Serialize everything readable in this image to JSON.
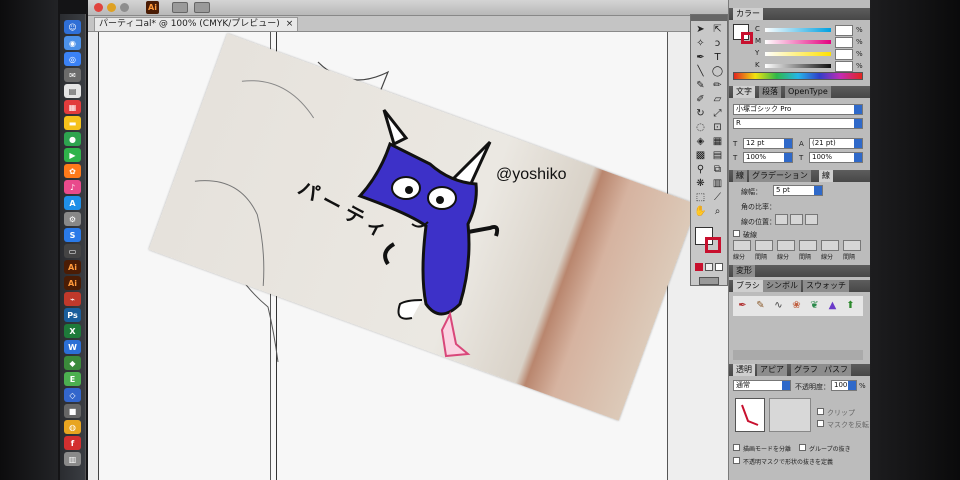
{
  "window": {
    "app_badge": "Ai",
    "doc_tab_title": "パーティコal* @ 100% (CMYK/プレビュー)",
    "doc_tab_close": "×"
  },
  "artwork": {
    "handle_text": "@yoshiko",
    "katakana_text": "パーティ"
  },
  "color_panel": {
    "tab_label": "カラー",
    "channels": [
      "C",
      "M",
      "Y",
      "K"
    ],
    "unit": "%",
    "fill_color": "#ffffff",
    "stroke_color": "#c8102e"
  },
  "character_panel": {
    "tabs": [
      "文字",
      "段落",
      "OpenType"
    ],
    "font_family": "小塚ゴシック Pro",
    "font_style": "R",
    "font_size": "12 pt",
    "leading": "(21 pt)",
    "vertical_scale": "100%",
    "horizontal_scale": "100%"
  },
  "stroke_panel": {
    "tabs": [
      "線",
      "グラデーション",
      "線"
    ],
    "weight_label": "線幅：",
    "weight_value": "5 pt",
    "cap_label": "角の比率：",
    "align_label": "線の位置：",
    "dashed_label": "破線",
    "dash_labels": [
      "線分",
      "間隔",
      "線分",
      "間隔",
      "線分",
      "間隔"
    ]
  },
  "transform_panel": {
    "tab_label": "変形"
  },
  "brush_panel": {
    "tabs": [
      "ブラシ",
      "シンボル",
      "スウォッチ"
    ]
  },
  "transparency_panel": {
    "tabs": [
      "透明",
      "アピア",
      "グラフ",
      "パスフ"
    ],
    "blend_mode": "通常",
    "opacity_label": "不透明度：",
    "opacity_value": "100",
    "opacity_unit": "%",
    "clip_label": "クリップ",
    "invert_mask_label": "マスクを反転",
    "isolate_label": "描画モードを分離",
    "knockout_label": "グループの抜き",
    "mask_opacity_label": "不透明マスクで形状の抜きを定義"
  },
  "colors": {
    "spectrum": [
      "#e2261f",
      "#f2e30f",
      "#2fb84a",
      "#26b6e8",
      "#2f3fc9",
      "#c32cb3",
      "#e2261f"
    ],
    "character_fill": "#3d31c8",
    "shoes": "#d9477a"
  }
}
